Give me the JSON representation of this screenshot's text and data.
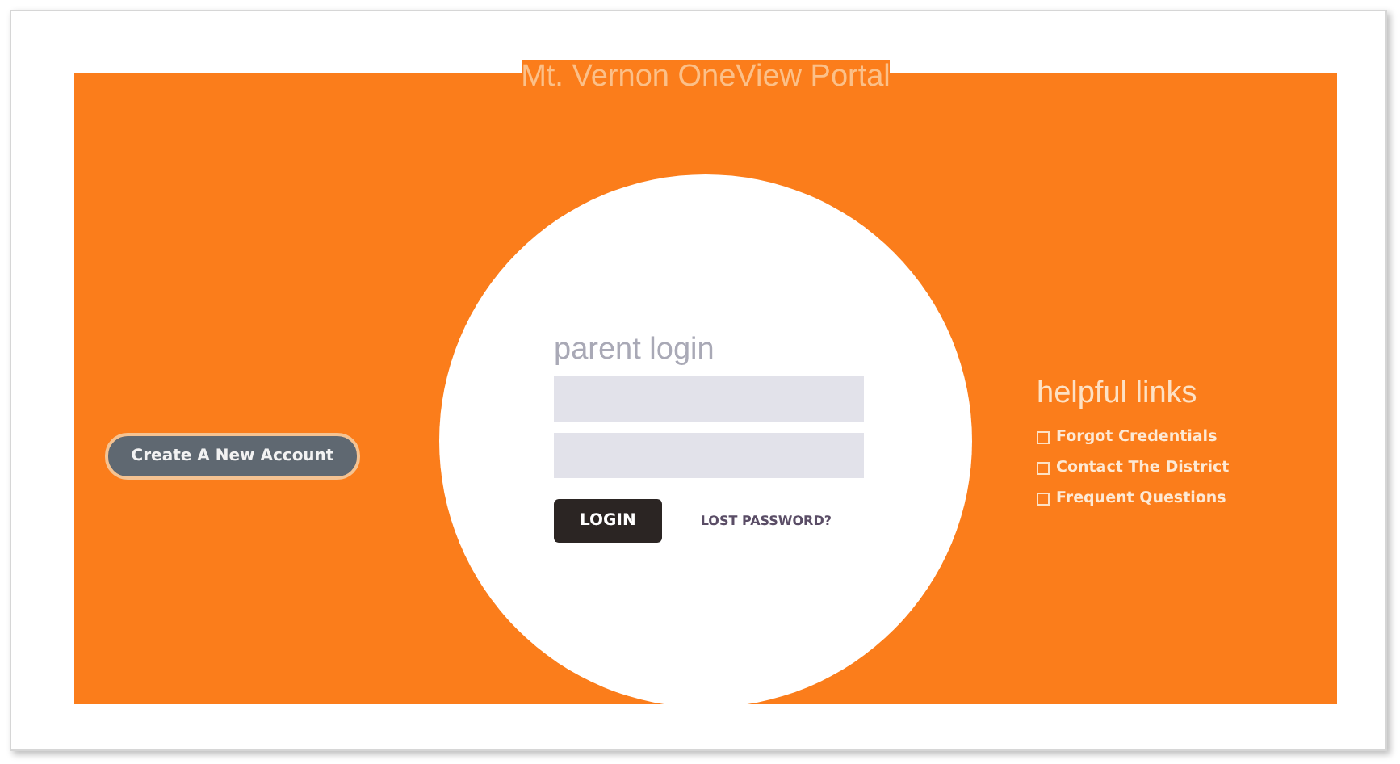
{
  "header": {
    "title": "Mt. Vernon OneView Portal"
  },
  "create_account": {
    "label": "Create A New Account"
  },
  "login": {
    "title": "parent login",
    "submit": "LOGIN",
    "lost_password": "LOST PASSWORD?"
  },
  "helpful_links": {
    "title": "helpful links",
    "items": [
      "Forgot Credentials",
      "Contact The District",
      "Frequent Questions"
    ]
  }
}
